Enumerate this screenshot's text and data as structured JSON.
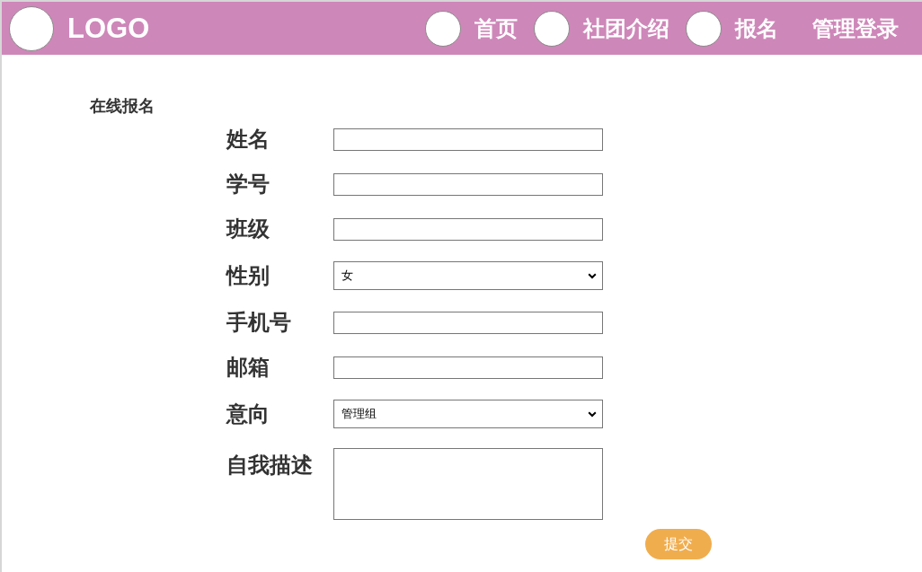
{
  "header": {
    "logo": "LOGO",
    "nav": [
      {
        "label": "首页",
        "icon": true
      },
      {
        "label": "社团介绍",
        "icon": true
      },
      {
        "label": "报名",
        "icon": true
      },
      {
        "label": "管理登录",
        "icon": false
      }
    ]
  },
  "form": {
    "title": "在线报名",
    "fields": [
      {
        "kind": "text",
        "label": "姓名"
      },
      {
        "kind": "text",
        "label": "学号"
      },
      {
        "kind": "text",
        "label": "班级"
      },
      {
        "kind": "select",
        "label": "性别",
        "value": "女"
      },
      {
        "kind": "text",
        "label": "手机号"
      },
      {
        "kind": "text",
        "label": "邮箱"
      },
      {
        "kind": "select",
        "label": "意向",
        "value": "管理组"
      },
      {
        "kind": "textarea",
        "label": "自我描述"
      }
    ],
    "submit": "提交"
  }
}
